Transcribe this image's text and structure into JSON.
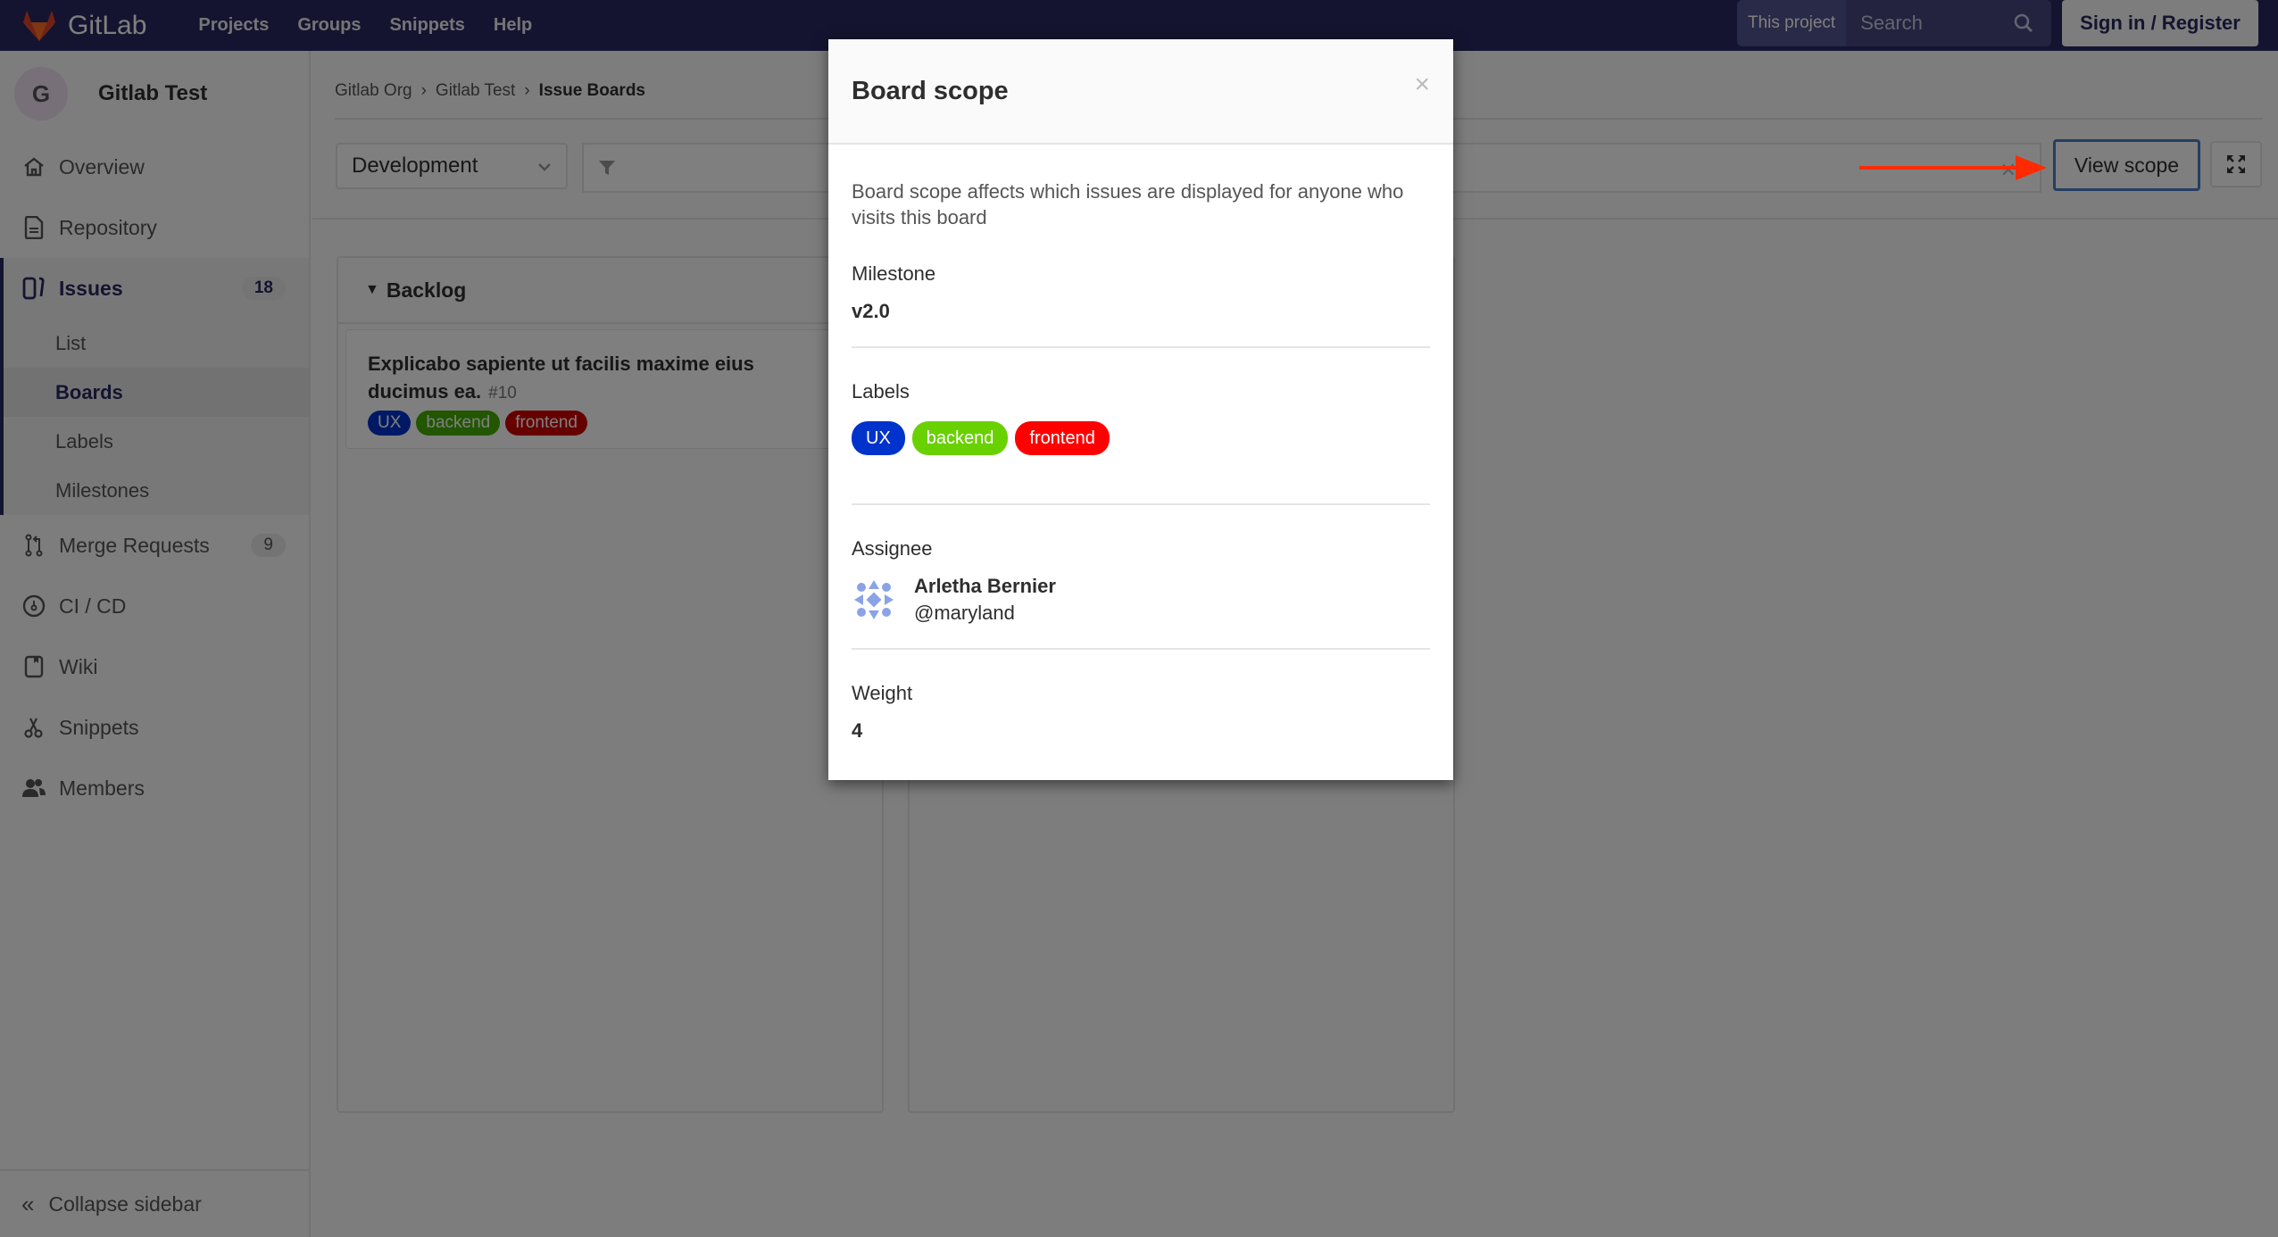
{
  "topbar": {
    "brand": "GitLab",
    "nav": [
      "Projects",
      "Groups",
      "Snippets",
      "Help"
    ],
    "search_scope": "This project",
    "search_placeholder": "Search",
    "signin_label": "Sign in / Register"
  },
  "sidebar": {
    "project_initial": "G",
    "project_name": "Gitlab Test",
    "items": [
      {
        "label": "Overview",
        "icon": "home-icon"
      },
      {
        "label": "Repository",
        "icon": "document-icon"
      },
      {
        "label": "Issues",
        "icon": "issues-icon",
        "badge": "18",
        "active": true
      },
      {
        "label": "Merge Requests",
        "icon": "merge-request-icon",
        "badge": "9"
      },
      {
        "label": "CI / CD",
        "icon": "rocket-gauge-icon"
      },
      {
        "label": "Wiki",
        "icon": "book-icon"
      },
      {
        "label": "Snippets",
        "icon": "scissors-icon"
      },
      {
        "label": "Members",
        "icon": "users-icon"
      }
    ],
    "issues_sub": [
      "List",
      "Boards",
      "Labels",
      "Milestones"
    ],
    "issues_sub_active": "Boards",
    "collapse_label": "Collapse sidebar"
  },
  "breadcrumb": [
    "Gitlab Org",
    "Gitlab Test",
    "Issue Boards"
  ],
  "filterbar": {
    "board_name": "Development",
    "filter_value": "",
    "view_scope_label": "View scope"
  },
  "board": {
    "columns": [
      {
        "title": "Backlog",
        "cards": [
          {
            "title": "Explicabo sapiente ut facilis maxime eius ducimus ea.",
            "number": "#10",
            "labels": [
              {
                "name": "UX",
                "color": "#0033cc"
              },
              {
                "name": "backend",
                "color": "#44ad00"
              },
              {
                "name": "frontend",
                "color": "#cc0000"
              }
            ]
          }
        ]
      },
      {
        "title": "",
        "cards": []
      }
    ]
  },
  "modal": {
    "title": "Board scope",
    "close_glyph": "×",
    "description": "Board scope affects which issues are displayed for anyone who visits this board",
    "milestone_label": "Milestone",
    "milestone_value": "v2.0",
    "labels_label": "Labels",
    "labels": [
      {
        "name": "UX",
        "color": "#0033cc"
      },
      {
        "name": "backend",
        "color": "#69d100"
      },
      {
        "name": "frontend",
        "color": "#ff0000"
      }
    ],
    "assignee_label": "Assignee",
    "assignee_name": "Arletha Bernier",
    "assignee_handle": "@maryland",
    "weight_label": "Weight",
    "weight_value": "4"
  },
  "colors": {
    "navbar": "#292961",
    "accent": "#292961",
    "annotation_arrow": "#ff2a00",
    "focus_ring": "#4b7cc4"
  }
}
